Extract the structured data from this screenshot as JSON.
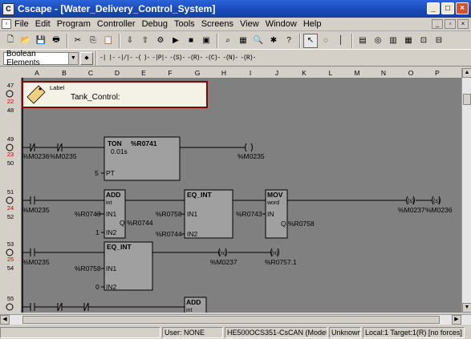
{
  "window": {
    "title": "Cscape - [Water_Delivery_Control_System]",
    "app_icon": "ladder-app-icon"
  },
  "menu": [
    "File",
    "Edit",
    "Program",
    "Controller",
    "Debug",
    "Tools",
    "Screens",
    "View",
    "Window",
    "Help"
  ],
  "toolbar2": {
    "combo_value": "Boolean Elements",
    "ladder_buttons": [
      "-| |-",
      "-|/|-",
      "-(",
      ")-",
      "-|P|-",
      "-(S)-",
      "-(R)-",
      "-(C)-",
      "-(N)-",
      "-(R)-"
    ]
  },
  "columns": [
    "A",
    "B",
    "C",
    "D",
    "E",
    "F",
    "G",
    "H",
    "I",
    "J",
    "K",
    "L",
    "M",
    "N",
    "O",
    "P"
  ],
  "label_box": {
    "type": "Label",
    "text": "Tank_Control:"
  },
  "rungs": [
    {
      "num": "47",
      "red": "22",
      "sub": "48"
    },
    {
      "num": "49",
      "red": "23",
      "sub": "50"
    },
    {
      "num": "51",
      "red": "24",
      "sub": "52"
    },
    {
      "num": "53",
      "red": "25",
      "sub": "54"
    },
    {
      "num": "55",
      "red": "",
      "sub": ""
    }
  ],
  "ladder_text": {
    "r23_c1": "%M0236",
    "r23_c2": "%M0235",
    "ton_title": "TON",
    "ton_reg": "%R0741",
    "ton_time": "0.01s",
    "ton_pt_val": "5",
    "ton_pt": "PT",
    "r23_coil": "%M0235",
    "r24_c1": "%M0235",
    "add1_title": "ADD",
    "add1_type": "int",
    "add1_in1_val": "%R0743",
    "add1_in1": "IN1",
    "add1_in2_val": "1",
    "add1_in2": "IN2",
    "add1_q": "Q",
    "add1_q_val": "%R0744",
    "eq1_title": "EQ_INT",
    "eq1_in1_val": "%R0758",
    "eq1_in1": "IN1",
    "eq1_in2_val": "%R0744",
    "eq1_in2": "IN2",
    "mov_title": "MOV",
    "mov_type": "word",
    "mov_in_val": "%R0743",
    "mov_in": "IN",
    "mov_q": "Q",
    "mov_q_val": "%R0758",
    "r24_coil1_sym": "(s)",
    "r24_coil1": "%M0237",
    "r24_coil2_sym": "(s)",
    "r24_coil2": "%M0236",
    "r25_c1": "%M0235",
    "eq2_title": "EQ_INT",
    "eq2_in1_val": "%R0758",
    "eq2_in1": "IN1",
    "eq2_in2_val": "0",
    "eq2_in2": "IN2",
    "r25_coil1_sym": "(n)",
    "r25_coil1": "%M0237",
    "r25_coil2_sym": "(n)",
    "r25_coil2": "%R0757.1",
    "add3_title": "ADD",
    "add3_type": "int"
  },
  "status": {
    "user": "User: NONE",
    "model": "HE500OCS351-CsCAN (Model Not-",
    "state": "Unknown",
    "targets": "Local:1  Target:1(R) [no forces]"
  }
}
